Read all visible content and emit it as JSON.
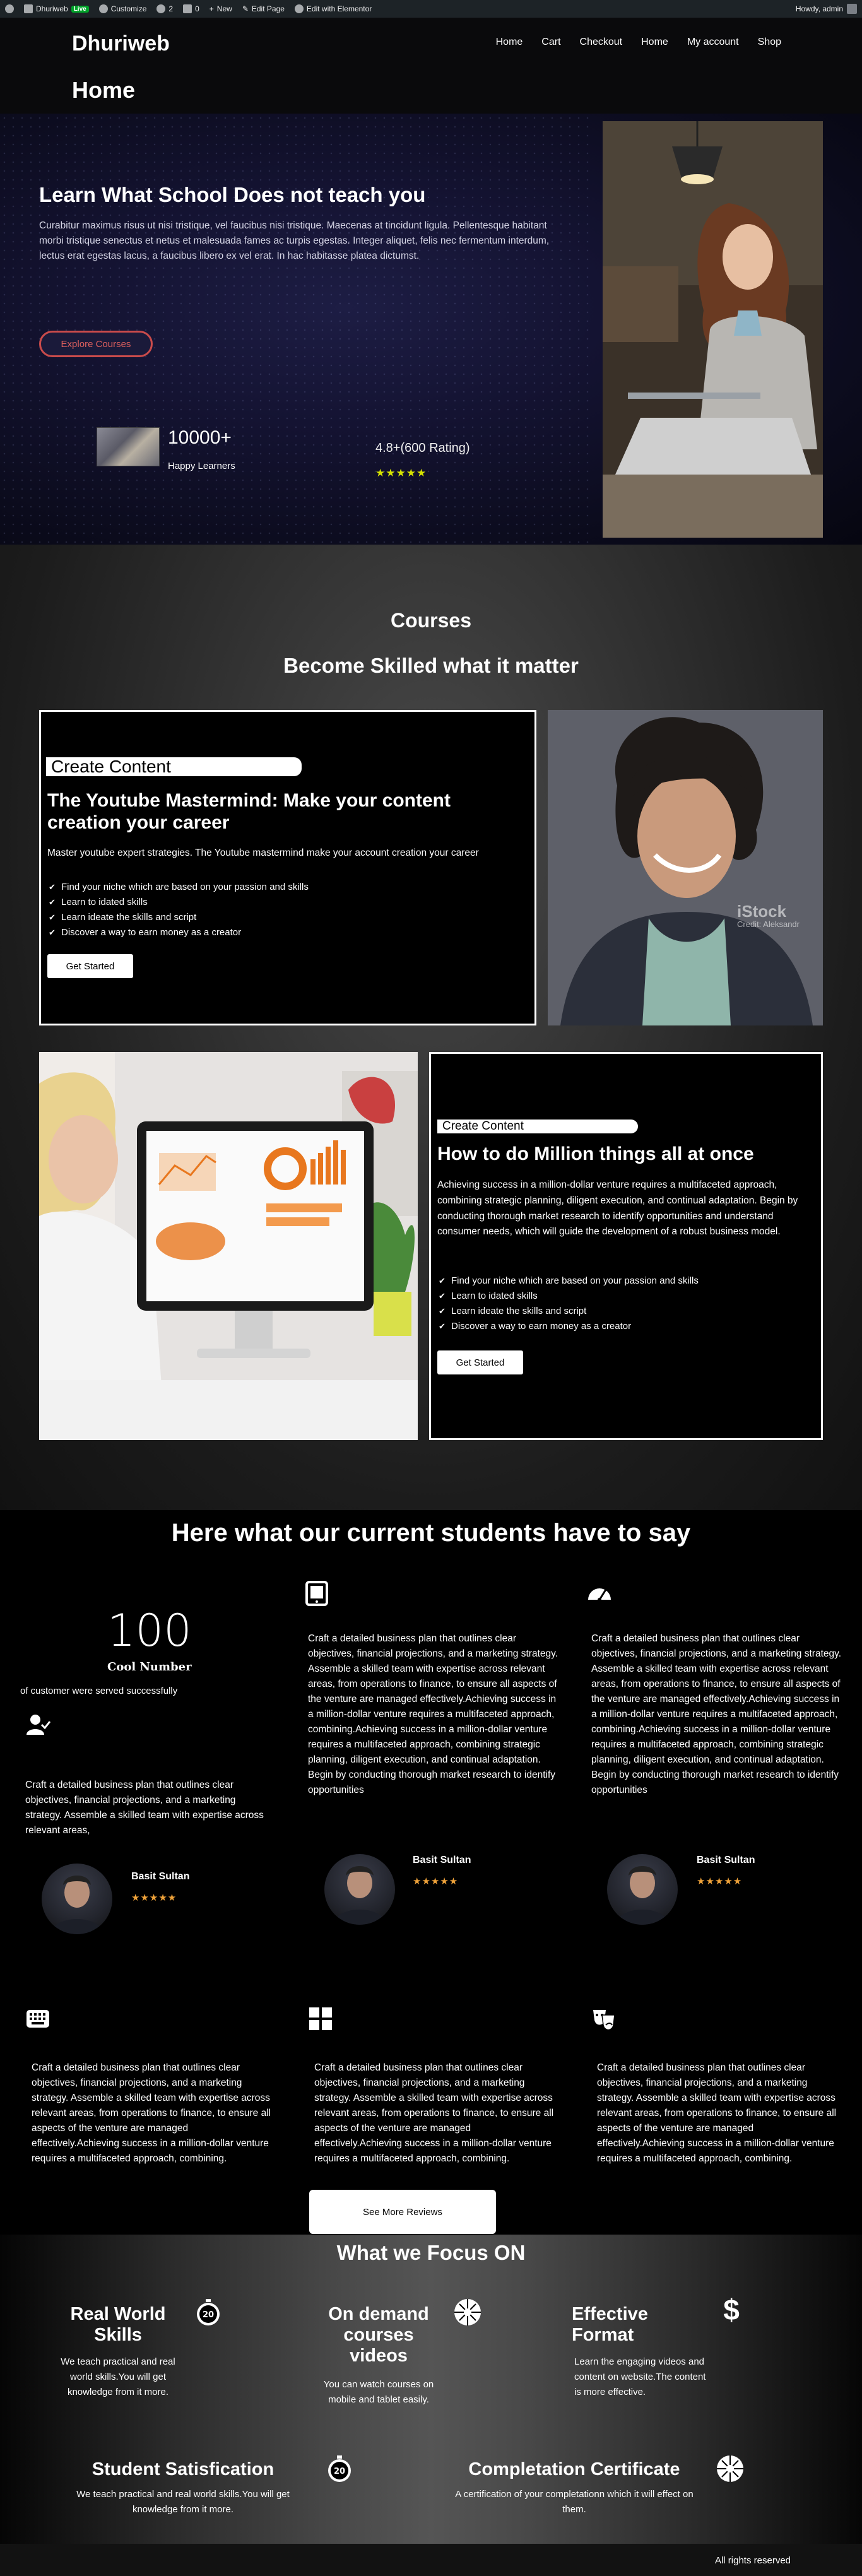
{
  "admin_bar": {
    "site_name": "Dhuriweb",
    "live_badge": "Live",
    "customize": "Customize",
    "updates_count": "2",
    "comments_count": "0",
    "new_label": "New",
    "edit_page": "Edit Page",
    "edit_elementor": "Edit with Elementor",
    "howdy": "Howdy, admin"
  },
  "header": {
    "site_title": "Dhuriweb",
    "page_heading": "Home",
    "nav": [
      "Home",
      "Cart",
      "Checkout",
      "Home",
      "My account",
      "Shop"
    ]
  },
  "hero": {
    "title": "Learn What School Does not teach you",
    "description": "Curabitur maximus risus ut nisi tristique, vel faucibus nisi tristique. Maecenas at tincidunt ligula. Pellentesque habitant morbi tristique senectus et netus et malesuada fames ac turpis egestas. Integer aliquet, felis nec fermentum interdum, lectus erat egestas lacus, a faucibus libero ex vel erat. In hac habitasse platea dictumst.",
    "button": "Explore Courses",
    "learners_count": "10000+",
    "learners_label": "Happy Learners",
    "rating_text": "4.8+(600 Rating)",
    "rating_stars": "★★★★★"
  },
  "courses": {
    "label": "Courses",
    "subtitle": "Become Skilled what it matter",
    "card1": {
      "tag": "Create Content",
      "title": "The Youtube Mastermind: Make your content creation your career",
      "description": "Master youtube expert strategies. The Youtube mastermind make your account creation your career",
      "bullets": [
        "Find your niche which are based on your passion and skills",
        "Learn to idated skills",
        "Learn ideate the skills and script",
        "Discover a way to earn money as a creator"
      ],
      "button": "Get Started",
      "photo_watermark": "iStock",
      "photo_credit": "Credit: Aleksandr"
    },
    "card2": {
      "tag": "Create Content",
      "title": "How to do Million things all at once",
      "description": "Achieving success in a million-dollar venture requires a multifaceted approach, combining strategic planning, diligent execution, and continual adaptation. Begin by conducting thorough market research to identify opportunities and understand consumer needs, which will guide the development of a robust business model.",
      "bullets": [
        "Find your niche which are based on your passion and skills",
        "Learn to idated skills",
        "Learn ideate the skills and script",
        "Discover a way to earn money as a creator"
      ],
      "button": "Get Started"
    }
  },
  "students": {
    "title": "Here what our current students have to say",
    "stat_number": "100",
    "stat_label": "Cool Number",
    "stat_description": "of customer were served successfully",
    "short_text": "Craft a detailed business plan that outlines clear objectives, financial projections, and a marketing strategy. Assemble a skilled team with expertise across relevant areas,",
    "long_text": "Craft a detailed business plan that outlines clear objectives, financial projections, and a marketing strategy. Assemble a skilled team with expertise across relevant areas, from operations to finance, to ensure all aspects of the venture are managed effectively.Achieving success in a million-dollar venture requires a multifaceted approach, combining.Achieving success in a million-dollar venture requires a multifaceted approach, combining strategic planning, diligent execution, and continual adaptation. Begin by conducting thorough market research to identify opportunities",
    "medium_text": "Craft a detailed business plan that outlines clear objectives, financial projections, and a marketing strategy. Assemble a skilled team with expertise across relevant areas, from operations to finance, to ensure all aspects of the venture are managed effectively.Achieving success in a million-dollar venture requires a multifaceted approach, combining.",
    "reviewer_name": "Basit Sultan",
    "reviewer_stars": "★★★★★",
    "more_button": "See More Reviews"
  },
  "focus": {
    "title": "What we Focus ON",
    "items": [
      {
        "title": "Real World Skills",
        "desc": "We teach practical and real world skills.You will get knowledge from it more."
      },
      {
        "title": "On demand courses videos",
        "desc": "You can watch courses on mobile and tablet easily."
      },
      {
        "title": "Effective Format",
        "desc": "Learn the engaging videos and content on website.The content is more effective."
      },
      {
        "title": "Student Satisfication",
        "desc": "We teach practical and real world skills.You will get knowledge from it more."
      },
      {
        "title": "Completation Certificate",
        "desc": "A certification of your completationn which it will effect on them."
      }
    ],
    "timer_icon_text": "20"
  },
  "footer": {
    "text": "All rights reserved"
  }
}
